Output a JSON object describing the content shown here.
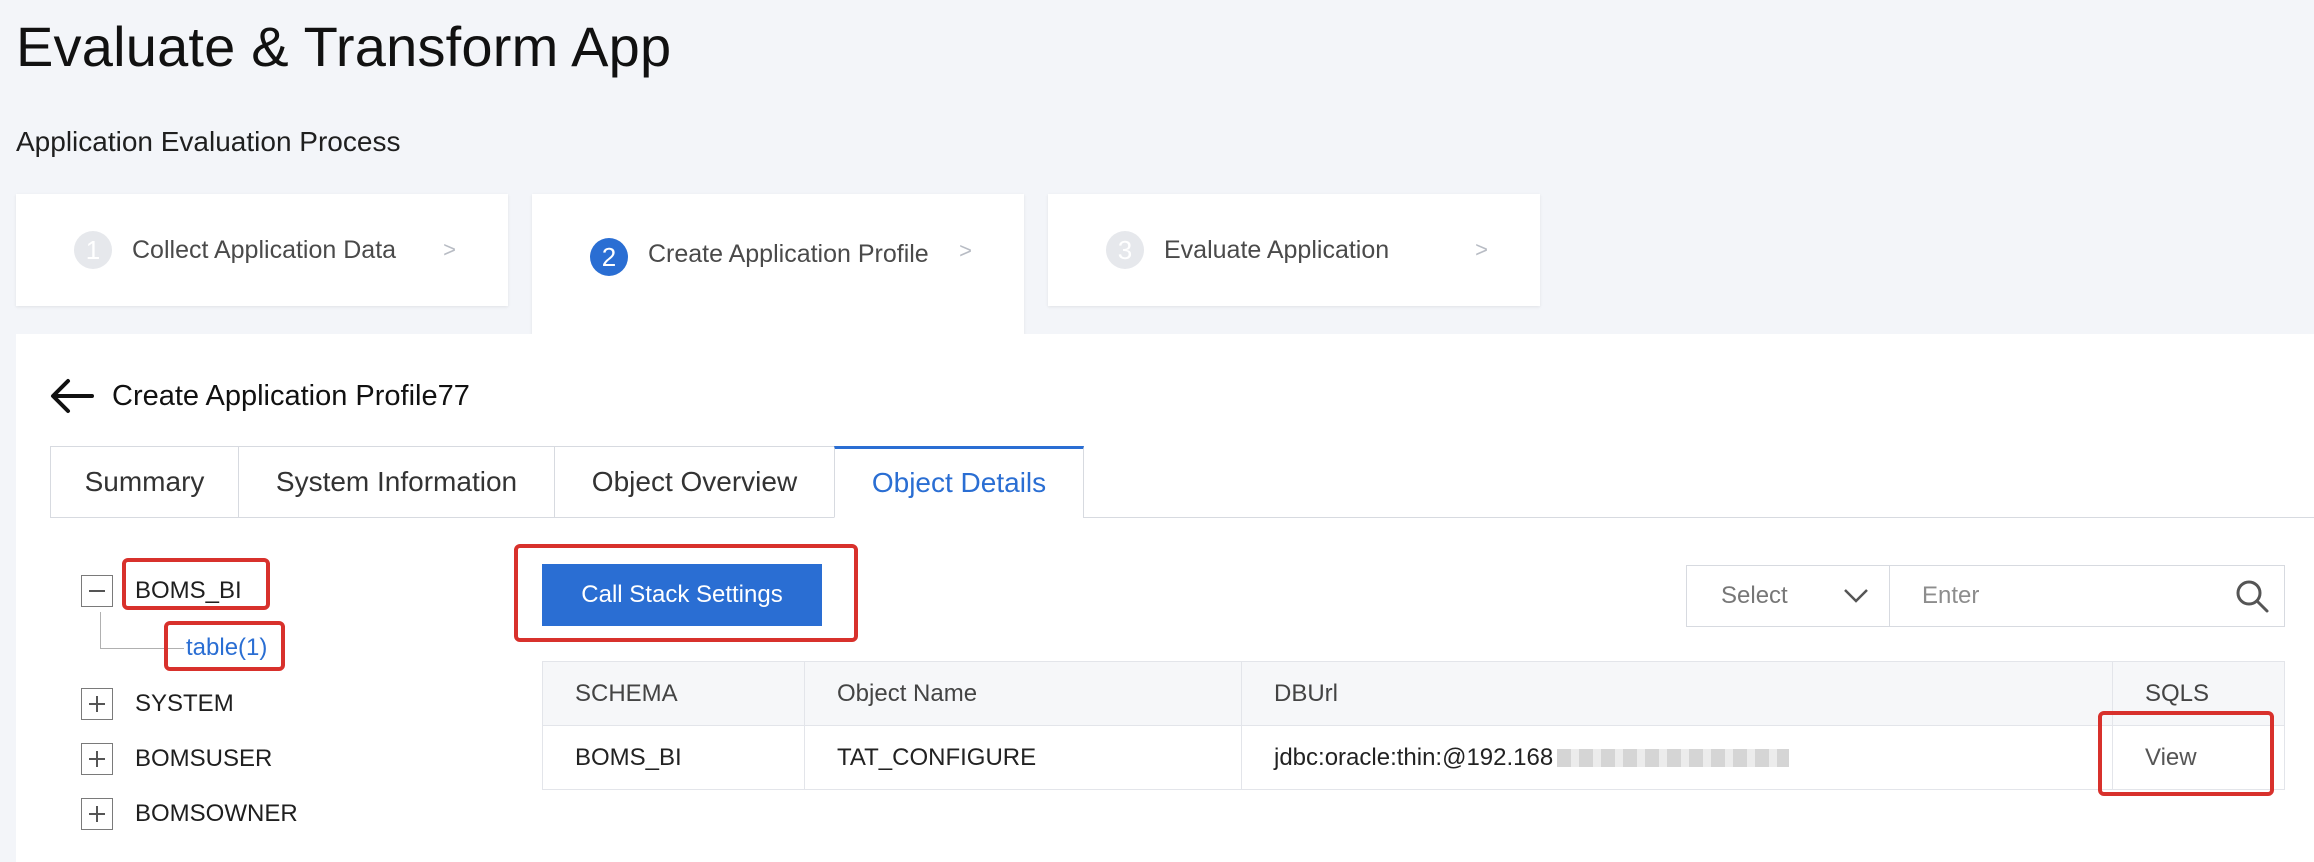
{
  "app": {
    "title": "Evaluate & Transform App"
  },
  "process": {
    "title": "Application Evaluation Process",
    "steps": [
      {
        "number": "1",
        "label": "Collect Application Data",
        "chevron": ">"
      },
      {
        "number": "2",
        "label": "Create Application Profile",
        "chevron": ">"
      },
      {
        "number": "3",
        "label": "Evaluate Application",
        "chevron": ">"
      }
    ]
  },
  "profile": {
    "title": "Create Application Profile77"
  },
  "tabs": [
    {
      "label": "Summary"
    },
    {
      "label": "System Information"
    },
    {
      "label": "Object Overview"
    },
    {
      "label": "Object Details"
    }
  ],
  "tree": {
    "nodes": [
      {
        "label": "BOMS_BI",
        "expanded": true,
        "children": [
          {
            "label": "table(1)"
          }
        ]
      },
      {
        "label": "SYSTEM",
        "expanded": false
      },
      {
        "label": "BOMSUSER",
        "expanded": false
      },
      {
        "label": "BOMSOWNER",
        "expanded": false
      }
    ]
  },
  "toolbar": {
    "call_stack_button": "Call Stack Settings",
    "select_placeholder": "Select",
    "search_placeholder": "Enter"
  },
  "table": {
    "columns": [
      "SCHEMA",
      "Object Name",
      "DBUrl",
      "SQLS"
    ],
    "rows": [
      {
        "schema": "BOMS_BI",
        "object_name": "TAT_CONFIGURE",
        "dburl": "jdbc:oracle:thin:@192.168",
        "sqls": "View"
      }
    ]
  },
  "colors": {
    "accent": "#2a6ed3",
    "highlight": "#d8312c"
  }
}
